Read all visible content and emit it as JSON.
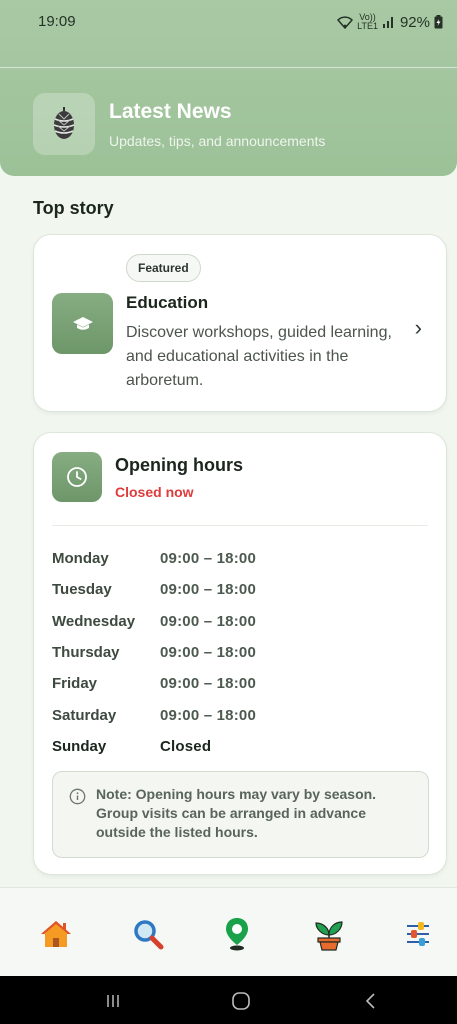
{
  "status_bar": {
    "time": "19:09",
    "network_top": "Vo))",
    "network_bottom": "LTE1",
    "battery": "92%"
  },
  "header": {
    "title": "Latest News",
    "subtitle": "Updates, tips, and announcements",
    "icon": "pinecone-icon"
  },
  "top_story": {
    "section_title": "Top story",
    "badge": "Featured",
    "title": "Education",
    "description": "Discover workshops, guided learning, and educational activities in the arboretum.",
    "icon": "graduation-cap-icon"
  },
  "opening_hours": {
    "title": "Opening hours",
    "status": "Closed now",
    "status_color": "#de3b3b",
    "days": [
      {
        "day": "Monday",
        "hours": "09:00 – 18:00"
      },
      {
        "day": "Tuesday",
        "hours": "09:00 – 18:00"
      },
      {
        "day": "Wednesday",
        "hours": "09:00 – 18:00"
      },
      {
        "day": "Thursday",
        "hours": "09:00 – 18:00"
      },
      {
        "day": "Friday",
        "hours": "09:00 – 18:00"
      },
      {
        "day": "Saturday",
        "hours": "09:00 – 18:00"
      },
      {
        "day": "Sunday",
        "hours": "Closed"
      }
    ],
    "note": "Note: Opening hours may vary by season. Group visits can be arranged in advance outside the listed hours."
  },
  "bottom_nav": {
    "items": [
      "home-icon",
      "search-icon",
      "map-pin-icon",
      "plant-icon",
      "settings-sliders-icon"
    ]
  },
  "colors": {
    "accent_green": "#7fa77b",
    "header_green": "#a2c59e",
    "closed_red": "#de3b3b"
  }
}
